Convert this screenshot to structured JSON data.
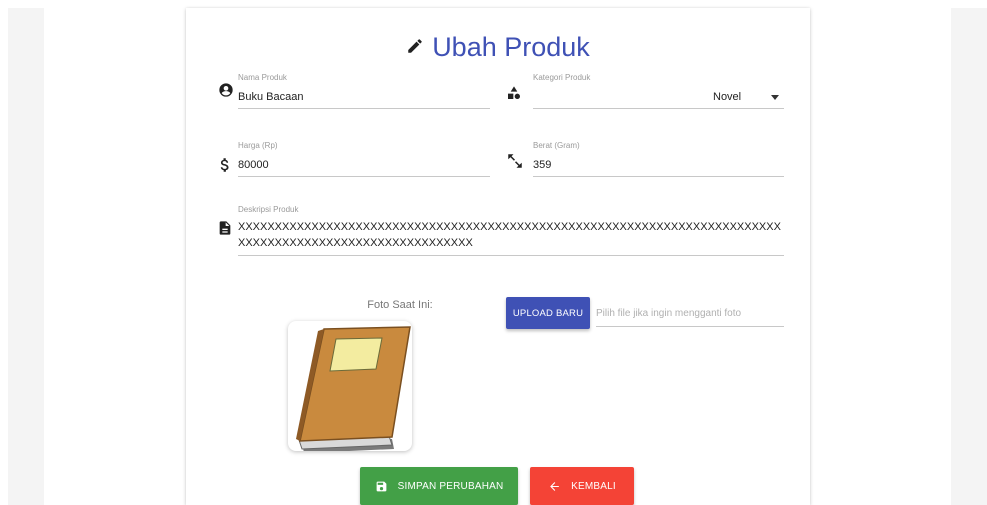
{
  "page": {
    "title": "Ubah Produk"
  },
  "form": {
    "nama": {
      "label": "Nama Produk",
      "value": "Buku Bacaan",
      "icon": "account-circle-icon"
    },
    "kategori": {
      "label": "Kategori Produk",
      "value": "Novel",
      "icon": "shapes-icon"
    },
    "harga": {
      "label": "Harga (Rp)",
      "value": "80000",
      "icon": "dollar-icon"
    },
    "berat": {
      "label": "Berat (Gram)",
      "value": "359",
      "icon": "resize-arrows-icon"
    },
    "deskripsi": {
      "label": "Deskripsi Produk",
      "value": "XXXXXXXXXXXXXXXXXXXXXXXXXXXXXXXXXXXXXXXXXXXXXXXXXXXXXXXXXXXXXXXXXXXXXXXXXXXXXXXXXXXXXXXXXXXXXXXXXXXXXXXXXX",
      "icon": "file-document-icon"
    }
  },
  "photo": {
    "label": "Foto Saat Ini:",
    "upload_label": "UPLOAD BARU",
    "file_placeholder": "Pilih file jika ingin mengganti foto"
  },
  "actions": {
    "save_label": "SIMPAN PERUBAHAN",
    "back_label": "KEMBALI"
  },
  "colors": {
    "primary": "#3f51b5",
    "save": "#43a047",
    "back": "#f44336"
  }
}
